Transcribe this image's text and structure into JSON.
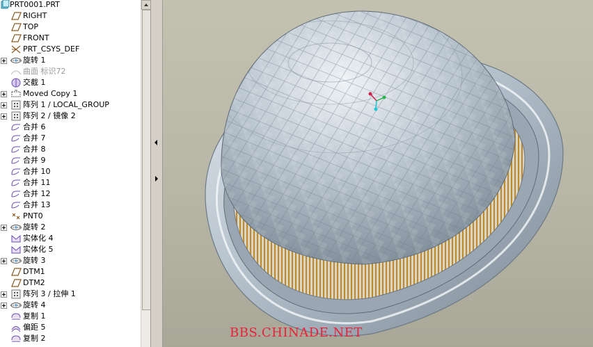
{
  "model_tree": {
    "items": [
      {
        "label": "PRT0001.PRT",
        "icon": "part-icon",
        "expander": false
      },
      {
        "label": "RIGHT",
        "icon": "datum-plane-icon",
        "expander": false
      },
      {
        "label": "TOP",
        "icon": "datum-plane-icon",
        "expander": false
      },
      {
        "label": "FRONT",
        "icon": "datum-plane-icon",
        "expander": false
      },
      {
        "label": "PRT_CSYS_DEF",
        "icon": "coordinate-system-icon",
        "expander": false
      },
      {
        "label": "旋转 1",
        "icon": "revolve-icon",
        "expander": true
      },
      {
        "label": "曲面 标识72",
        "icon": "surface-icon",
        "expander": false,
        "suppressed": true
      },
      {
        "label": "交截 1",
        "icon": "intersect-icon",
        "expander": false
      },
      {
        "label": "Moved Copy 1",
        "icon": "moved-copy-icon",
        "expander": true
      },
      {
        "label": "阵列 1 / LOCAL_GROUP",
        "icon": "pattern-icon",
        "expander": true
      },
      {
        "label": "阵列 2 / 镜像 2",
        "icon": "pattern-icon",
        "expander": true
      },
      {
        "label": "合并 6",
        "icon": "merge-icon",
        "expander": false
      },
      {
        "label": "合并 7",
        "icon": "merge-icon",
        "expander": false
      },
      {
        "label": "合并 8",
        "icon": "merge-icon",
        "expander": false
      },
      {
        "label": "合并 9",
        "icon": "merge-icon",
        "expander": false
      },
      {
        "label": "合并 10",
        "icon": "merge-icon",
        "expander": false
      },
      {
        "label": "合并 11",
        "icon": "merge-icon",
        "expander": false
      },
      {
        "label": "合并 12",
        "icon": "merge-icon",
        "expander": false
      },
      {
        "label": "合并 13",
        "icon": "merge-icon",
        "expander": false
      },
      {
        "label": "PNT0",
        "icon": "datum-point-icon",
        "expander": false
      },
      {
        "label": "旋转 2",
        "icon": "revolve-icon",
        "expander": true
      },
      {
        "label": "实体化 4",
        "icon": "solidify-icon",
        "expander": false
      },
      {
        "label": "实体化 5",
        "icon": "solidify-icon",
        "expander": false
      },
      {
        "label": "旋转 3",
        "icon": "revolve-icon",
        "expander": true
      },
      {
        "label": "DTM1",
        "icon": "datum-plane-icon",
        "expander": false
      },
      {
        "label": "DTM2",
        "icon": "datum-plane-icon",
        "expander": false
      },
      {
        "label": "阵列 3 / 拉伸 1",
        "icon": "pattern-icon",
        "expander": true
      },
      {
        "label": "旋转 4",
        "icon": "revolve-icon",
        "expander": true
      },
      {
        "label": "复制 1",
        "icon": "copy-icon",
        "expander": false
      },
      {
        "label": "偏距 5",
        "icon": "offset-icon",
        "expander": false
      },
      {
        "label": "复制 2",
        "icon": "copy-icon",
        "expander": false
      }
    ]
  },
  "viewport": {
    "watermark": "BBS.CHINADE.NET"
  },
  "colors": {
    "viewport_bg": "#bdbbab",
    "model_surface": "#b8c4cf",
    "pattern_hatch": "#c08a2a",
    "watermark": "#e8223a",
    "datum_icon": "#8a5a22"
  }
}
